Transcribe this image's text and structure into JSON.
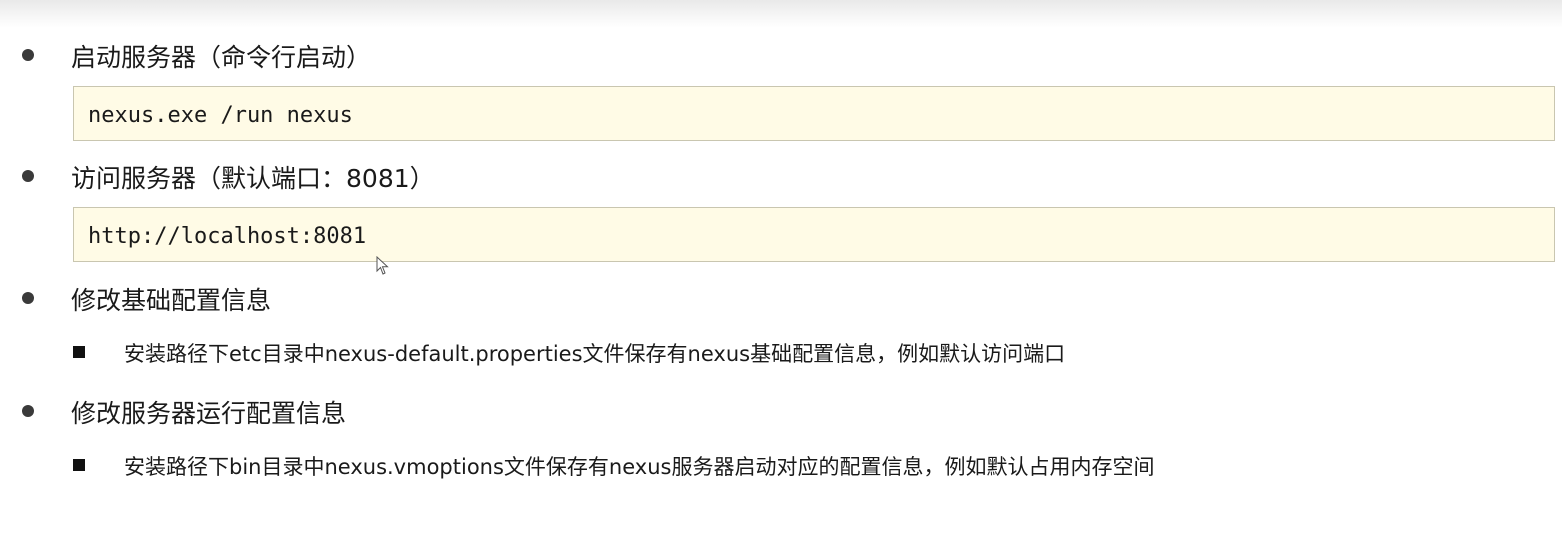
{
  "items": [
    {
      "label": "启动服务器（命令行启动）",
      "code": "nexus.exe /run nexus"
    },
    {
      "label": "访问服务器（默认端口：8081）",
      "code": "http://localhost:8081"
    },
    {
      "label": "修改基础配置信息",
      "sub": "安装路径下etc目录中nexus-default.properties文件保存有nexus基础配置信息，例如默认访问端口"
    },
    {
      "label": "修改服务器运行配置信息",
      "sub": "安装路径下bin目录中nexus.vmoptions文件保存有nexus服务器启动对应的配置信息，例如默认占用内存空间"
    }
  ]
}
